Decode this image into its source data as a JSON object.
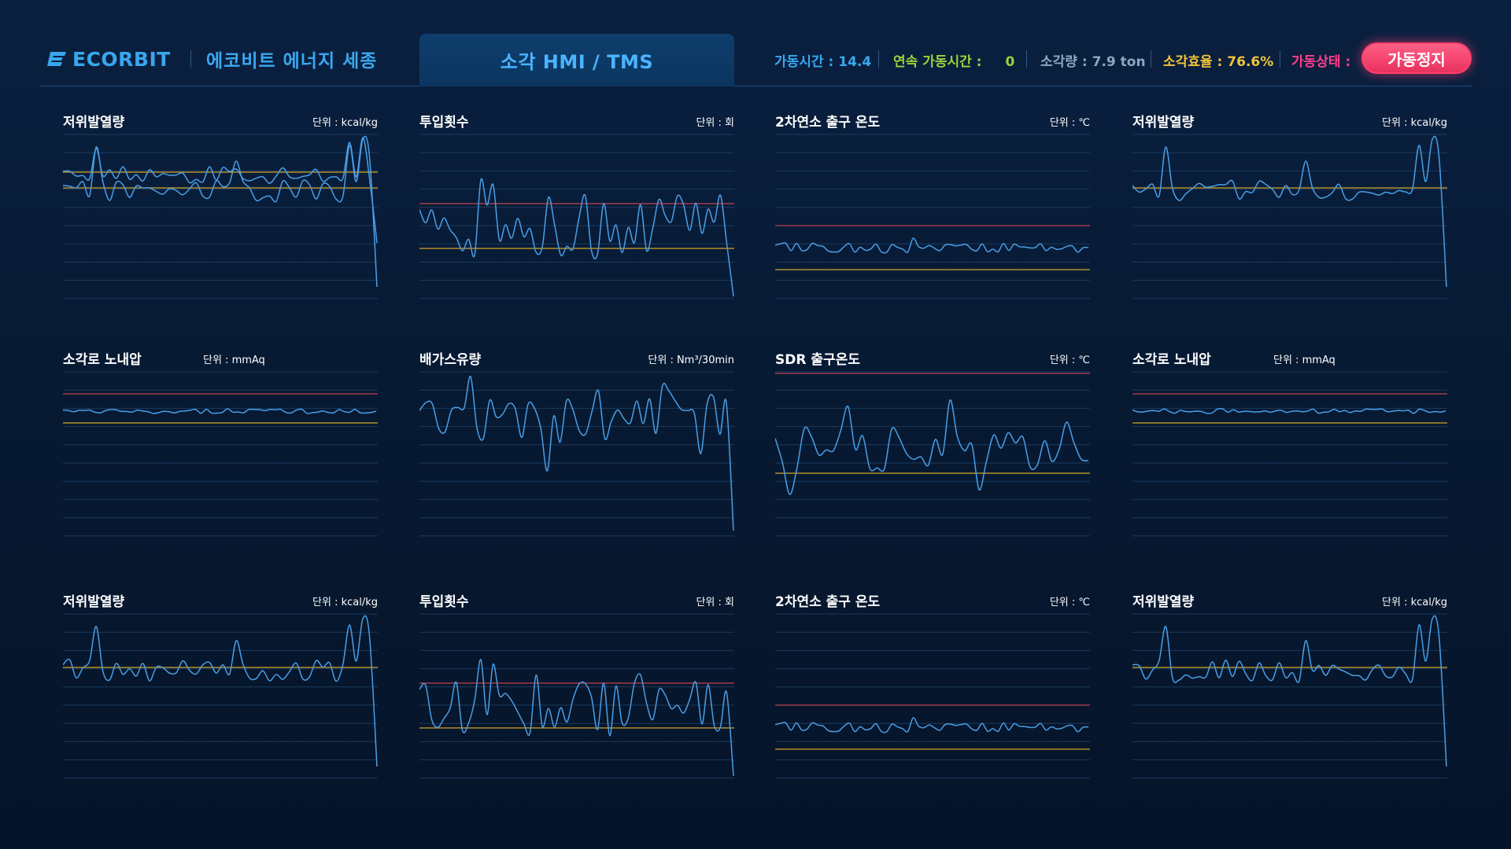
{
  "header": {
    "logo_text": "ECORBIT",
    "company": "에코비트 에너지 세종",
    "active_tab": "소각 HMI  /  TMS",
    "stats": [
      {
        "label": "가동시간 :",
        "value": "14.4",
        "color": "#3aa8f0"
      },
      {
        "label": "연속 가동시간 :",
        "value": "0",
        "color": "#9bd23c"
      },
      {
        "label": "소각량 :",
        "value": "7.9 ton",
        "color": "#8fa6c2"
      },
      {
        "label": "소각효율 :",
        "value": "76.6%",
        "color": "#f2c33a"
      },
      {
        "label": "가동상태 :",
        "value": "",
        "color": "#ff3f8a"
      }
    ],
    "status_button": "가동정지"
  },
  "colors": {
    "line": "#4a9ee6",
    "grid": "#1a3a5e",
    "red_limit": "#c0424f",
    "yellow_limit": "#d4a623"
  },
  "panels": [
    {
      "title": "저위발열량",
      "unit": "단위 : kcal/kg",
      "kind": "heat",
      "variant": "double"
    },
    {
      "title": "투입횟수",
      "unit": "단위 : 회",
      "kind": "count"
    },
    {
      "title": "2차연소 출구 온도",
      "unit": "단위 : ℃",
      "kind": "temp"
    },
    {
      "title": "저위발열량",
      "unit": "단위 : kcal/kg",
      "kind": "heat"
    },
    {
      "title": "소각로 노내압",
      "unit": "단위 : mmAq",
      "kind": "pressure"
    },
    {
      "title": "배가스유량",
      "unit": "단위 : Nm³/30min",
      "kind": "flow"
    },
    {
      "title": "SDR 출구온도",
      "unit": "단위 : ℃",
      "kind": "sdr"
    },
    {
      "title": "소각로 노내압",
      "unit": "단위 : mmAq",
      "kind": "pressure"
    },
    {
      "title": "저위발열량",
      "unit": "단위 : kcal/kg",
      "kind": "heat"
    },
    {
      "title": "투입횟수",
      "unit": "단위 : 회",
      "kind": "count"
    },
    {
      "title": "2차연소 출구 온도",
      "unit": "단위 : ℃",
      "kind": "temp"
    },
    {
      "title": "저위발열량",
      "unit": "단위 : kcal/kg",
      "kind": "heat"
    }
  ]
}
